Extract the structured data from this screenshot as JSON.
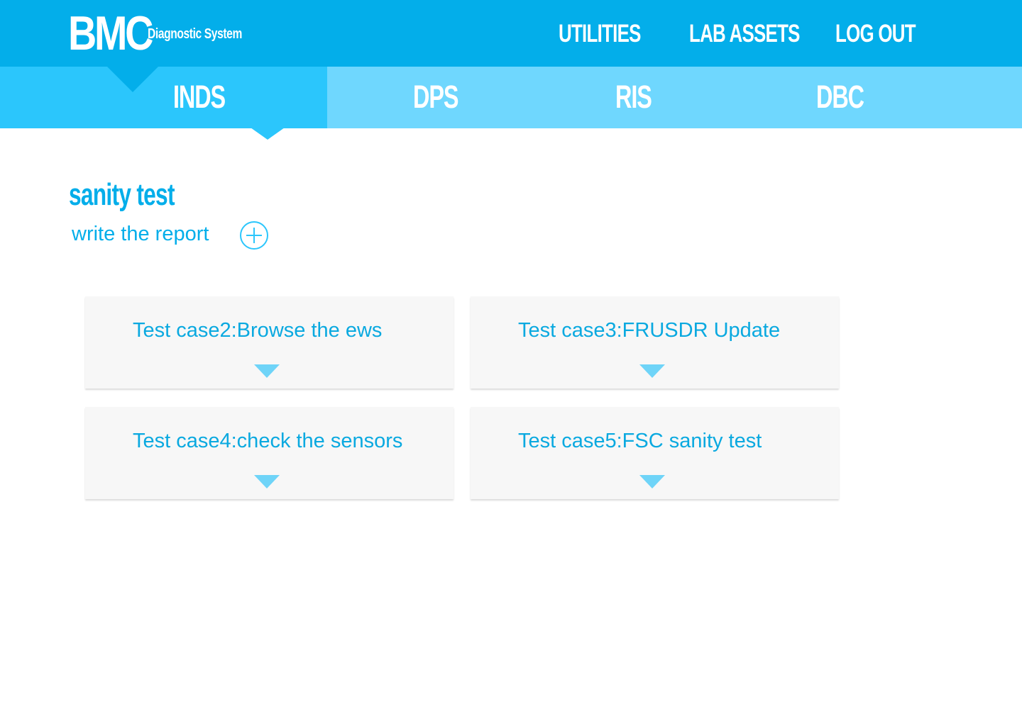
{
  "header": {
    "logo": "BMC",
    "subtitle": "Diagnostic System",
    "nav": {
      "utilities": "UTILITIES",
      "lab_assets": "LAB ASSETS",
      "log_out": "LOG OUT"
    }
  },
  "tabs": [
    {
      "label": "INDS",
      "active": true
    },
    {
      "label": "DPS",
      "active": false
    },
    {
      "label": "RIS",
      "active": false
    },
    {
      "label": "DBC",
      "active": false
    }
  ],
  "page": {
    "title": "sanity test",
    "write_report": "write the report",
    "add_icon": "plus-circle-icon"
  },
  "cards": [
    {
      "title": "Test case2:Browse the ews",
      "icon": "caret-down-icon"
    },
    {
      "title": "Test case3:FRUSDR Update",
      "icon": "caret-down-icon"
    },
    {
      "title": "Test case4:check the sensors",
      "icon": "caret-down-icon"
    },
    {
      "title": "Test case5:FSC sanity test",
      "icon": "caret-down-icon"
    }
  ],
  "colors": {
    "header_bg": "#03aeea",
    "tab_bar_bg": "#6fd7fe",
    "tab_active_bg": "#2bc6fc",
    "accent_text": "#03aeea",
    "card_bg": "#f7f7f7",
    "caret": "#6fd4f8"
  }
}
